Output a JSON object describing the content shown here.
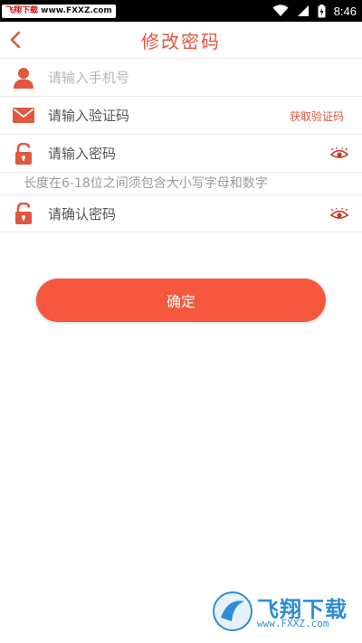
{
  "status_bar": {
    "watermark_brand": "飞翔下载",
    "watermark_url": "www.FXXZ.com",
    "time": "8:46"
  },
  "header": {
    "title": "修改密码",
    "back_icon": "chevron-left-icon"
  },
  "form": {
    "phone_placeholder": "请输入手机号",
    "code_placeholder": "请输入验证码",
    "get_code_label": "获取验证码",
    "password_placeholder": "请输入密码",
    "password_hint": "长度在6-18位之间须包含大小写字母和数字",
    "confirm_password_placeholder": "请确认密码"
  },
  "actions": {
    "confirm_label": "确定"
  },
  "bottom_watermark": {
    "text": "飞翔下载",
    "url": "www.FXXZ.com"
  },
  "colors": {
    "accent": "#e0563f",
    "button": "#f5573c",
    "hint": "#9a9a9a",
    "divider": "#ececec"
  }
}
